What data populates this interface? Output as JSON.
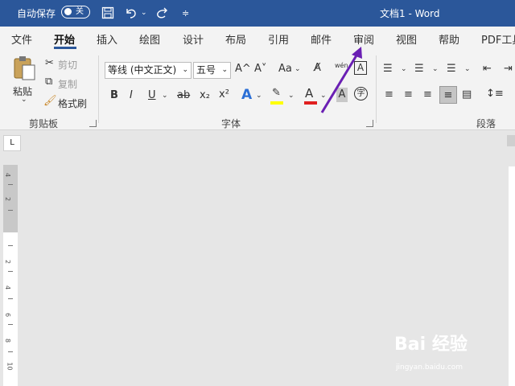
{
  "titlebar": {
    "autosave_label": "自动保存",
    "autosave_state": "关",
    "doc_title": "文档1  -  Word"
  },
  "tabs": [
    "文件",
    "开始",
    "插入",
    "绘图",
    "设计",
    "布局",
    "引用",
    "邮件",
    "审阅",
    "视图",
    "帮助",
    "PDF工具"
  ],
  "clipboard": {
    "paste": "粘贴",
    "cut": "剪切",
    "copy": "复制",
    "format_painter": "格式刷",
    "group": "剪贴板"
  },
  "font": {
    "name": "等线 (中文正文)",
    "size": "五号",
    "group": "字体",
    "grow": "A^",
    "shrink": "A˅",
    "case": "Aa",
    "bold": "B",
    "italic": "I",
    "underline": "U",
    "strike": "ab",
    "sub": "x₂",
    "sup": "x²"
  },
  "paragraph": {
    "group": "段落"
  },
  "ruler_corner": "L",
  "ruler_numbers": [
    "4",
    "2",
    "2",
    "4",
    "6",
    "8",
    "10"
  ],
  "watermark": {
    "brand": "Bai 经验",
    "url": "jingyan.baidu.com"
  },
  "colors": {
    "titlebar": "#2b579a",
    "highlight": "#ffff00",
    "font_color": "#e02020",
    "annotation_arrow": "#6a1fb3"
  }
}
